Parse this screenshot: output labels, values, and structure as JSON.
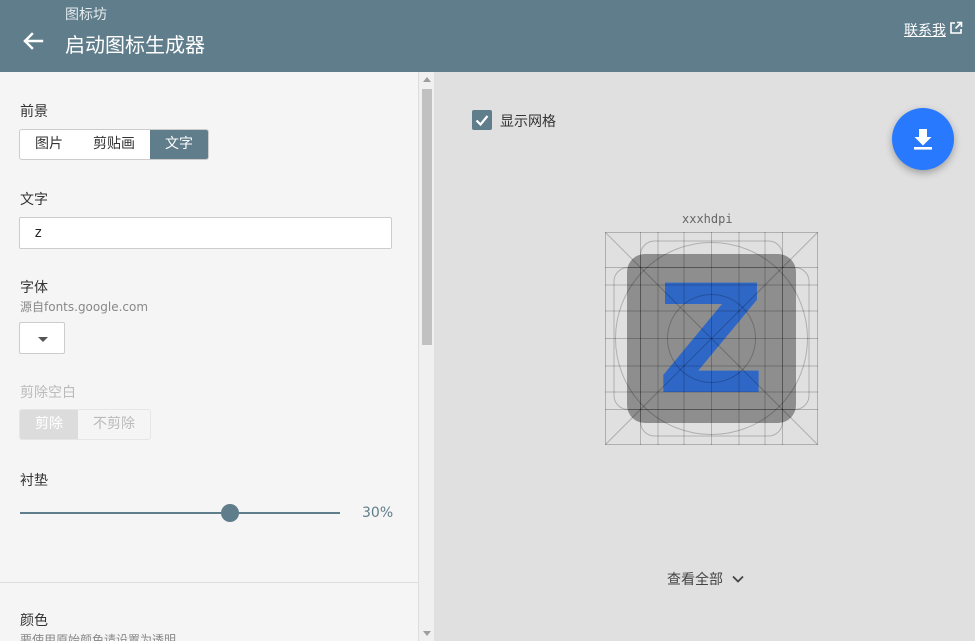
{
  "header": {
    "site_name": "图标坊",
    "title": "启动图标生成器",
    "contact_label": "联系我"
  },
  "sidebar": {
    "foreground": {
      "label": "前景",
      "options": [
        "图片",
        "剪贴画",
        "文字"
      ],
      "selected": "文字"
    },
    "text": {
      "label": "文字",
      "value": "z"
    },
    "font": {
      "label": "字体",
      "hint": "源自fonts.google.com"
    },
    "trim": {
      "label": "剪除空白",
      "options": [
        "剪除",
        "不剪除"
      ],
      "selected": "剪除"
    },
    "padding": {
      "label": "衬垫",
      "value_label": "30%",
      "value": 30
    },
    "color": {
      "label": "颜色",
      "hint": "要使用原始颜色请设置为透明"
    }
  },
  "preview": {
    "show_grid_label": "显示网格",
    "show_grid": true,
    "density_label": "xxxhdpi",
    "glyph": "Z",
    "view_all_label": "查看全部"
  },
  "colors": {
    "primary": "#607d8b",
    "accent": "#2979ff",
    "icon_bg": "#8e8e8e",
    "glyph": "#2f67c7"
  },
  "icons": {
    "back": "arrow-left-icon",
    "external": "external-link-icon",
    "download": "download-icon",
    "check": "checkmark-icon",
    "chevron": "chevron-down-icon"
  }
}
